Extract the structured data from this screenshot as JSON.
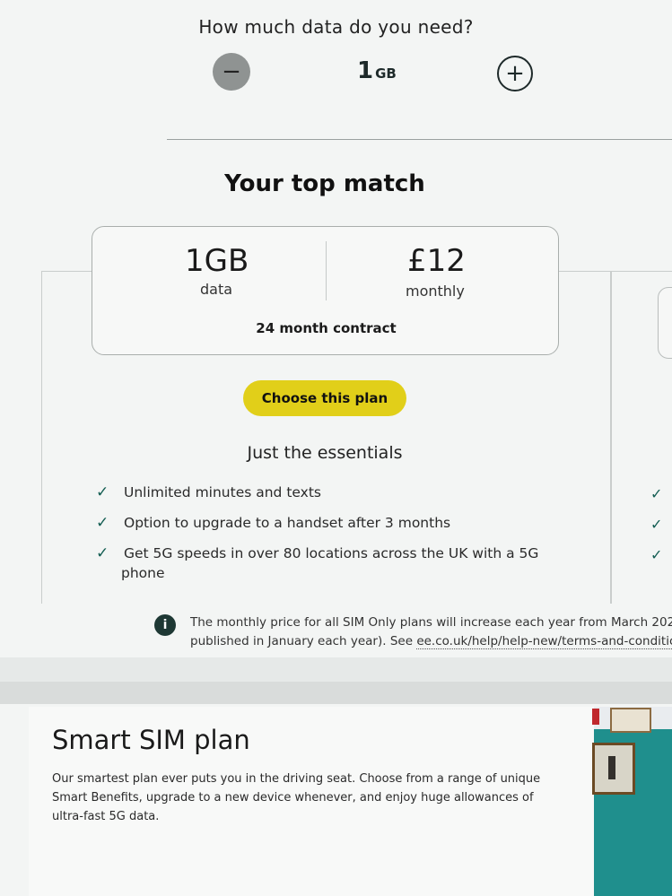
{
  "data_selector": {
    "title": "How much data do you need?",
    "minus_icon": "minus-icon",
    "minus_glyph": "−",
    "value": "1",
    "unit": "GB",
    "plus_icon": "plus-icon",
    "plus_glyph": "+"
  },
  "section_title": "Your top match",
  "plan_card": {
    "data_value": "1GB",
    "data_label": "data",
    "price_value": "£12",
    "price_label": "monthly",
    "contract": "24 month contract"
  },
  "cta": {
    "label": "Choose this plan",
    "color": "#e1cf19"
  },
  "features": {
    "title": "Just the essentials",
    "tick_glyph": "✓",
    "items": [
      "Unlimited minutes and texts",
      "Option to upgrade to a handset after 3 months",
      "Get 5G speeds in over 80 locations across the UK with a 5G"
    ],
    "last_item_continuation": "phone"
  },
  "notice": {
    "icon": "info-icon",
    "icon_glyph": "i",
    "line1": "The monthly price for all SIM Only plans will increase each year from March 202",
    "line2_prefix": "published in January each year). See ",
    "line2_link": "ee.co.uk/help/help-new/terms-and-conditic"
  },
  "promo": {
    "title": "Smart SIM plan",
    "body": "Our smartest plan ever puts you in the driving seat. Choose from a range of unique Smart Benefits, upgrade to a new device whenever, and enjoy huge allowances of ultra-fast 5G data."
  },
  "colors": {
    "accent_dark": "#1e3834",
    "tick": "#135d52",
    "promo_image_bg": "#1f8f8d"
  }
}
